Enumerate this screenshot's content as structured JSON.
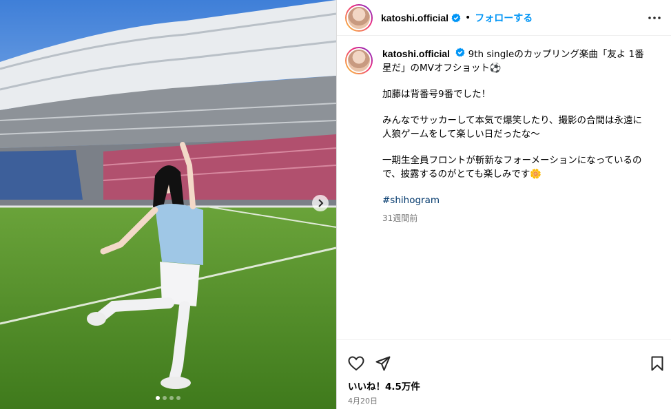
{
  "post": {
    "username": "katoshi.official",
    "follow_label": "フォローする",
    "separator": "•",
    "caption_line1": "9th singleのカップリング楽曲「友よ 1番星だ」のMVオフショット⚽",
    "caption_p2": "加藤は背番号9番でした！",
    "caption_p3": "みんなでサッカーして本気で爆笑したり、撮影の合間は永遠に人狼ゲームをして楽しい日だったな〜",
    "caption_p4": "一期生全員フロントが斬新なフォーメーションになっているので、披露するのがとても楽しみです🌼",
    "hashtag": "#shihogram",
    "time_ago": "31週間前",
    "likes": "いいね！4.5万件",
    "date": "4月20日"
  },
  "icons": {
    "verified": "verified-badge-icon",
    "more": "more-options-icon",
    "heart": "heart-icon",
    "share": "share-icon",
    "save": "bookmark-icon",
    "next": "chevron-right-icon"
  },
  "carousel": {
    "slides": 4,
    "active": 1
  },
  "colors": {
    "accent": "#0095f6",
    "verified": "#0095f6",
    "hashtag": "#00376b",
    "muted": "#737373"
  }
}
